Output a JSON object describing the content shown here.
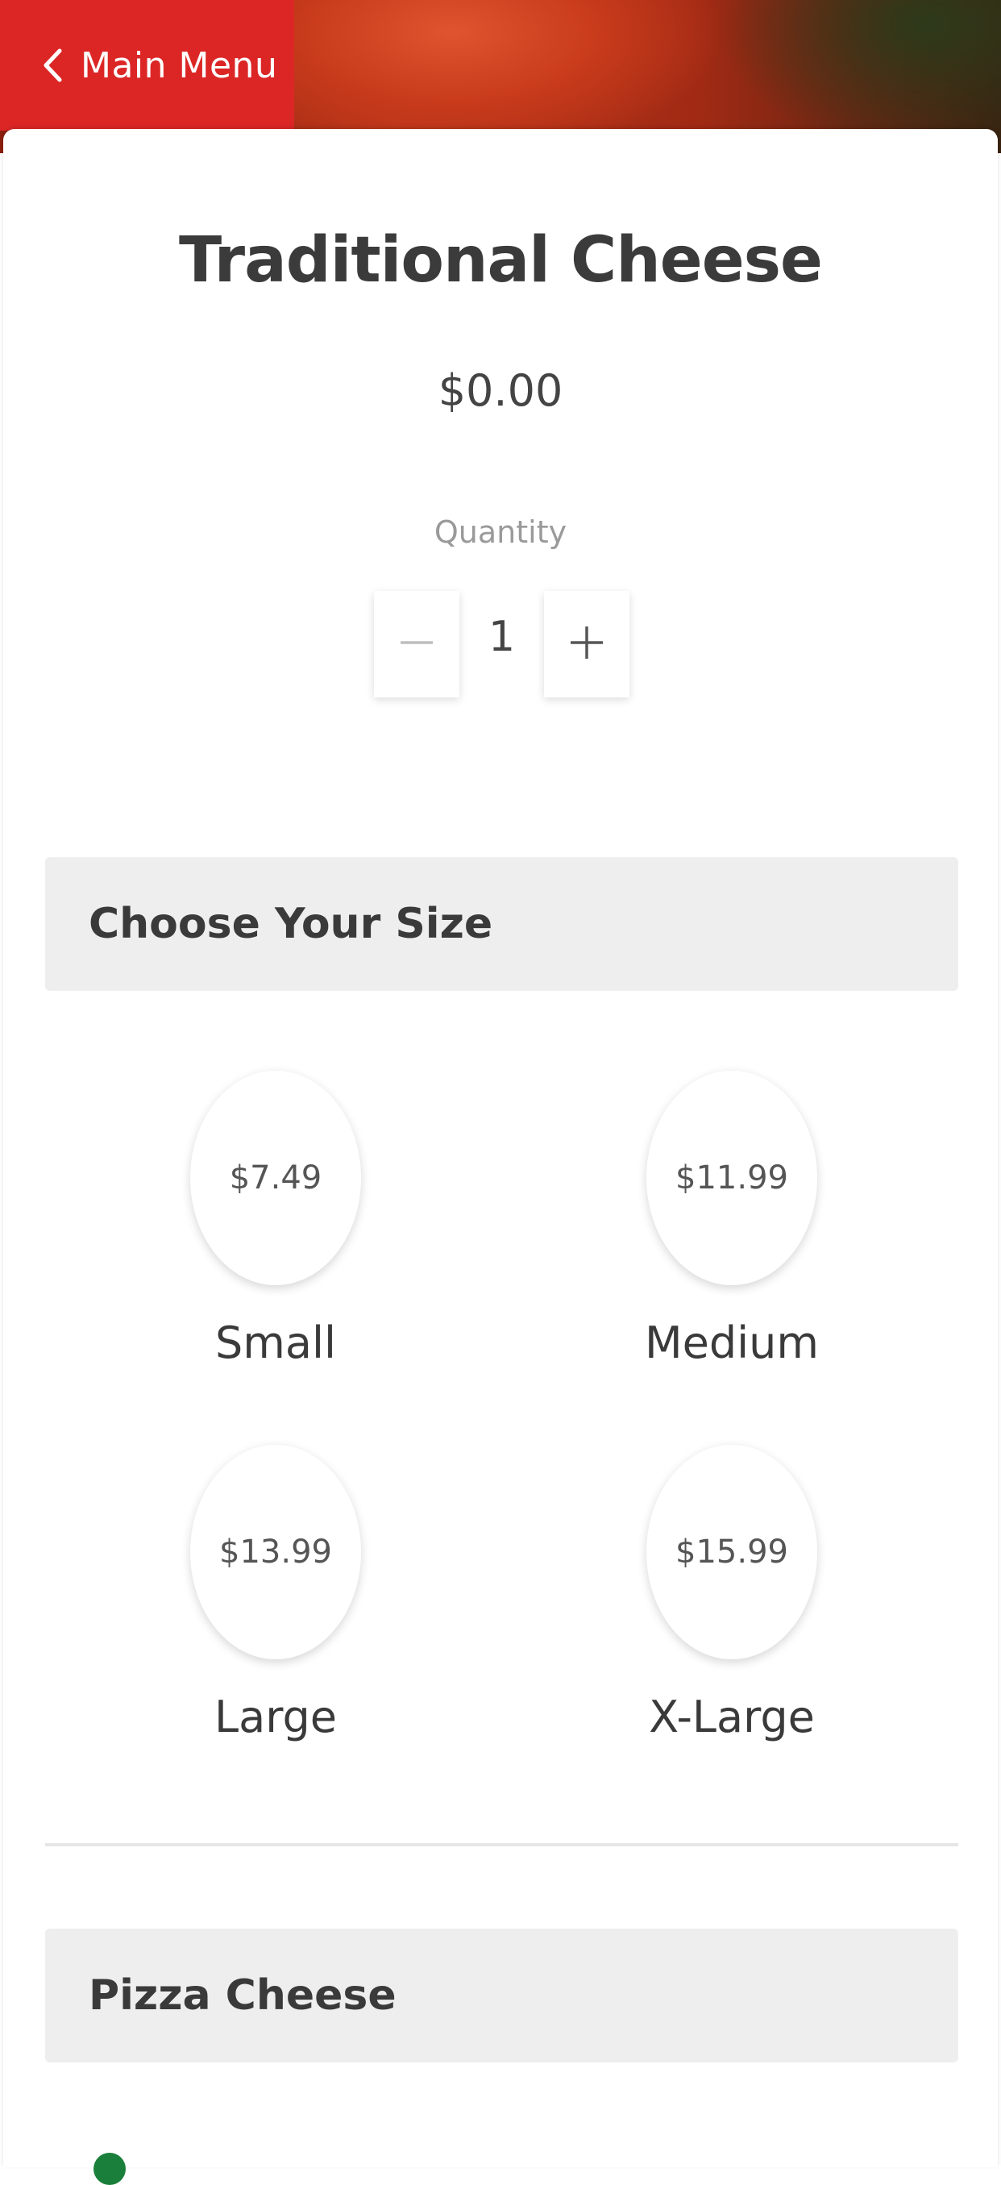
{
  "nav": {
    "back_label": "Main Menu"
  },
  "item": {
    "title": "Traditional Cheese",
    "price": "$0.00"
  },
  "quantity": {
    "label": "Quantity",
    "value": "1"
  },
  "sections": {
    "size_title": "Choose Your Size",
    "cheese_title": "Pizza Cheese"
  },
  "sizes": [
    {
      "name": "Small",
      "price": "$7.49"
    },
    {
      "name": "Medium",
      "price": "$11.99"
    },
    {
      "name": "Large",
      "price": "$13.99"
    },
    {
      "name": "X-Large",
      "price": "$15.99"
    }
  ],
  "colors": {
    "accent": "#dc2626",
    "section_bg": "#eeeeee",
    "peek_green": "#1a7f3a"
  },
  "icons": {
    "back": "chevron-left-icon",
    "decrement": "minus-icon",
    "increment": "plus-icon"
  }
}
